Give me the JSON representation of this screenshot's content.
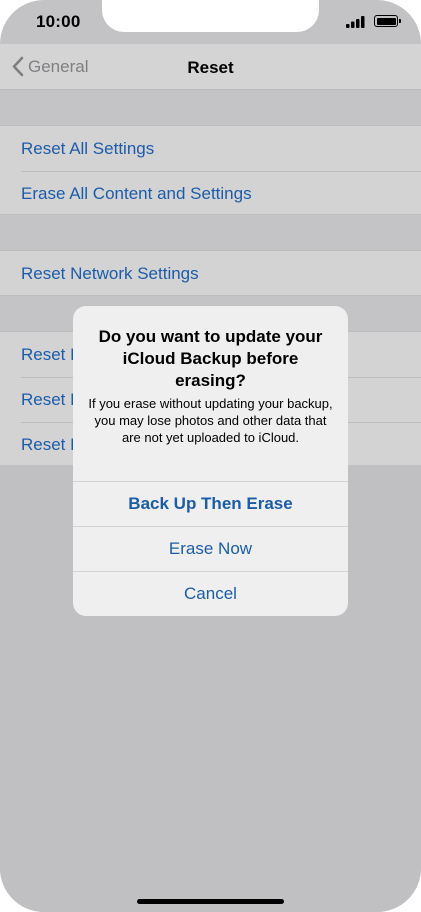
{
  "status": {
    "time": "10:00"
  },
  "nav": {
    "back_label": "General",
    "title": "Reset"
  },
  "groups": [
    {
      "items": [
        "Reset All Settings",
        "Erase All Content and Settings"
      ]
    },
    {
      "items": [
        "Reset Network Settings"
      ]
    },
    {
      "items": [
        "Reset K",
        "Reset H",
        "Reset L"
      ]
    }
  ],
  "alert": {
    "title": "Do you want to update your iCloud Backup before erasing?",
    "message": "If you erase without updating your backup, you may lose photos and other data that are not yet uploaded to iCloud.",
    "buttons": [
      "Back Up Then Erase",
      "Erase Now",
      "Cancel"
    ]
  },
  "colors": {
    "link": "#1b5caa",
    "background": "#c3c3c6",
    "alert": "#efefef"
  },
  "icons": [
    "chevron-left-icon",
    "signal-icon",
    "wifi-icon",
    "battery-icon"
  ]
}
